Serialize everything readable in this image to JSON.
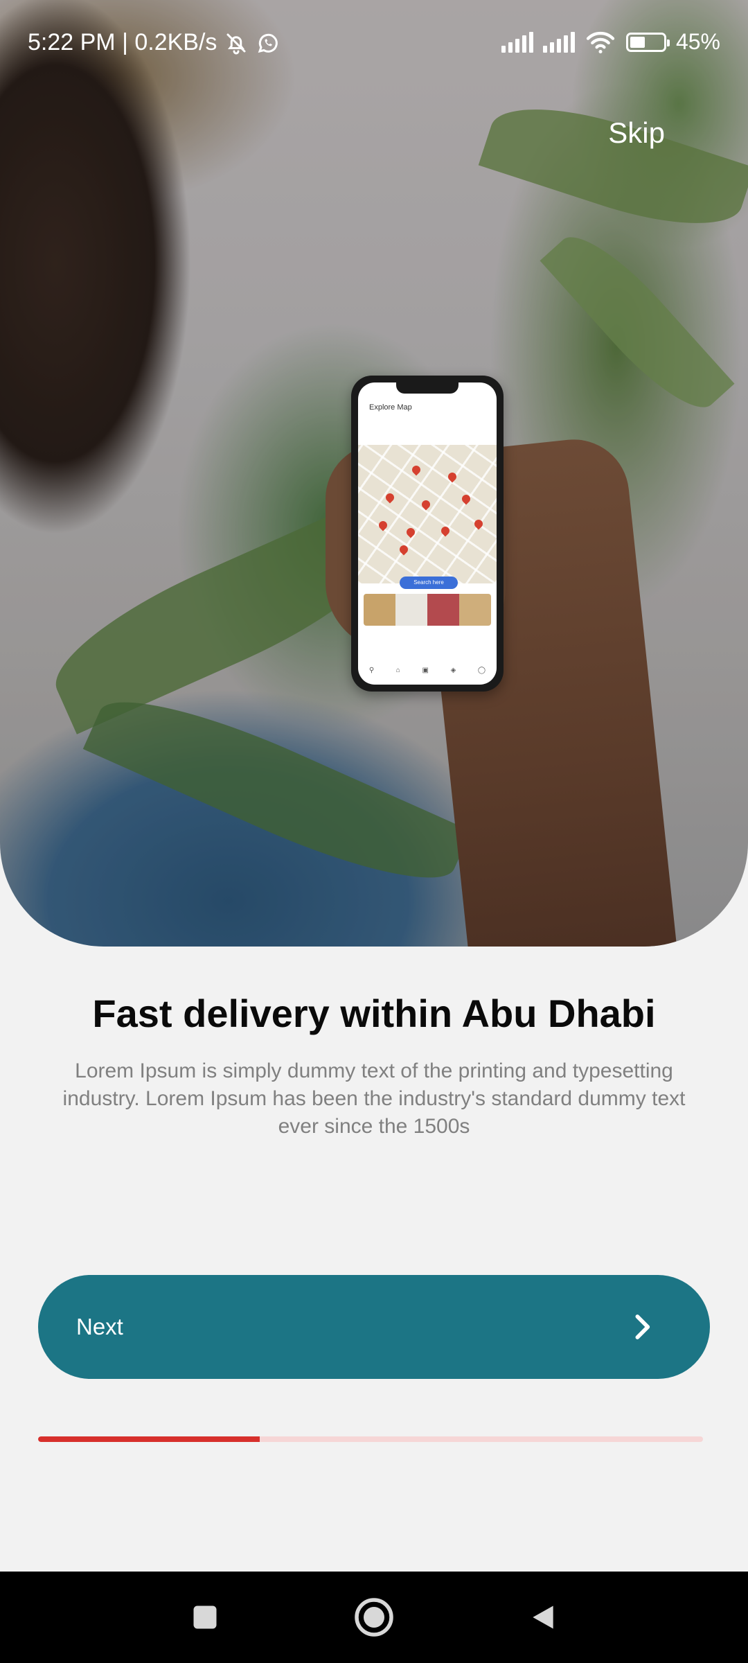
{
  "status_bar": {
    "time_text": "5:22 PM | 0.2KB/s",
    "battery_text": "45%",
    "battery_level": 0.45
  },
  "icons": {
    "mute": "bell-off-icon",
    "whatsapp": "whatsapp-icon",
    "signal": "signal-icon",
    "wifi": "wifi-icon",
    "battery": "battery-icon",
    "next": "chevron-right-icon",
    "recents": "square-icon",
    "home": "home-circle-icon",
    "back": "back-triangle-icon"
  },
  "onboarding": {
    "skip_label": "Skip",
    "title": "Fast delivery within Abu Dhabi",
    "description": "Lorem Ipsum is simply dummy text of the printing and typesetting industry. Lorem Ipsum has been the industry's standard dummy text ever since the 1500s",
    "next_label": "Next",
    "progress_fraction": 0.333
  },
  "hero_phone": {
    "screen_title": "Explore Map",
    "search_label": "Search here"
  },
  "colors": {
    "button": "#1c7585",
    "progress_active": "#d7302c",
    "progress_track": "#f6d6d6",
    "background": "#f2f2f2"
  }
}
